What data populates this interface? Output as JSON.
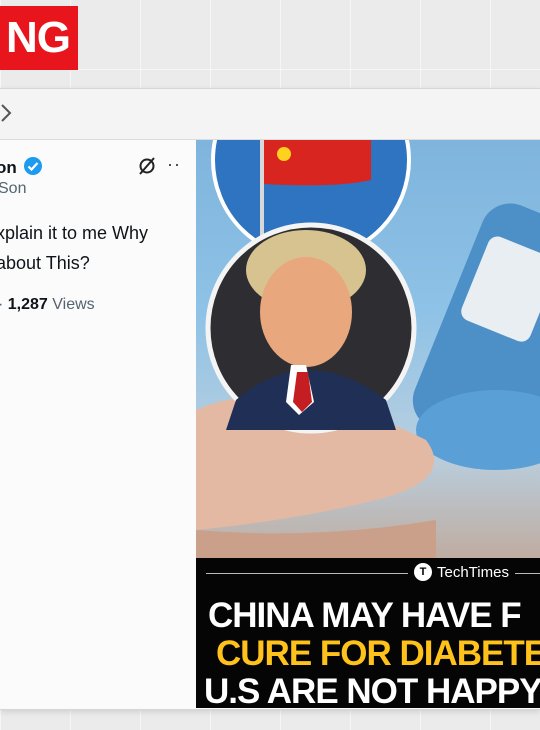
{
  "badge": {
    "text": "NG"
  },
  "post": {
    "name": "on",
    "handle": "Son",
    "text": "xplain it to me Why about This?",
    "views_count": "1,287",
    "views_label": "Views",
    "views_prefix": "·"
  },
  "media": {
    "brand": "TechTimes",
    "headline1": "CHINA MAY HAVE F",
    "headline2": "CURE FOR DIABETES",
    "headline3": "U.S ARE NOT HAPPY"
  },
  "colors": {
    "badge_red": "#e8161c",
    "verified_blue": "#1d9bf0",
    "headline_yellow": "#ffc21a"
  }
}
